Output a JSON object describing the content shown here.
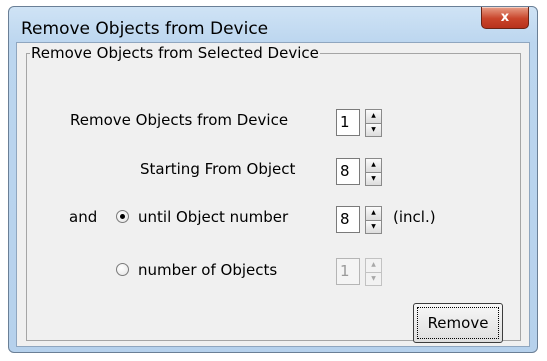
{
  "window": {
    "title": "Remove Objects from Device",
    "close_glyph": "x",
    "close_icon": "close-icon"
  },
  "group": {
    "label": "Remove Objects from Selected Device"
  },
  "form": {
    "device_label": "Remove Objects from Device",
    "device_value": "1",
    "start_label": "Starting From Object",
    "start_value": "8",
    "and_label": "and",
    "until_label": "until Object number",
    "until_value": "8",
    "until_selected": true,
    "incl_label": "(incl.)",
    "count_label": "number of Objects",
    "count_value": "1",
    "count_enabled": false
  },
  "buttons": {
    "remove_label": "Remove"
  }
}
